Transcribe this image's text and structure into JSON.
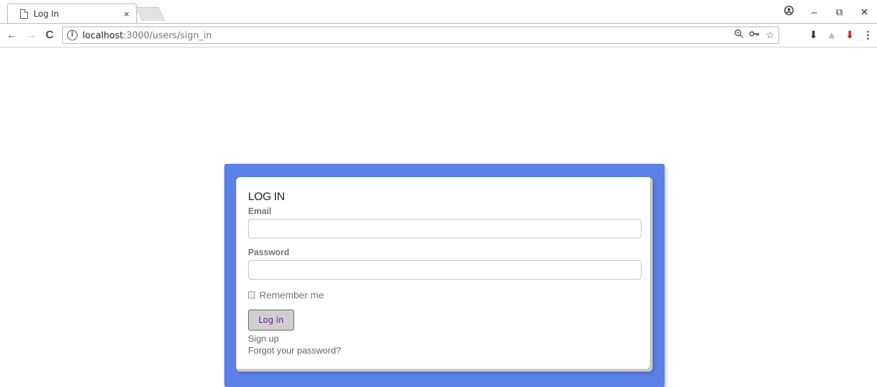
{
  "browser": {
    "tab_title": "Log In",
    "tab_close": "×",
    "url_host": "localhost",
    "url_rest": ":3000/users/sign_in",
    "window_controls": [
      "–",
      "⧉",
      "✕"
    ],
    "account_icon": "account-circle-icon"
  },
  "form": {
    "title": "LOG IN",
    "email_label": "Email",
    "email_value": "",
    "password_label": "Password",
    "password_value": "",
    "remember_label": "Remember me",
    "remember_checked": false,
    "submit_label": "Log in",
    "signup_link": "Sign up",
    "forgot_link": "Forgot your password?"
  },
  "colors": {
    "panel_border": "#5b80e6",
    "button_text": "#6a1b9a"
  }
}
